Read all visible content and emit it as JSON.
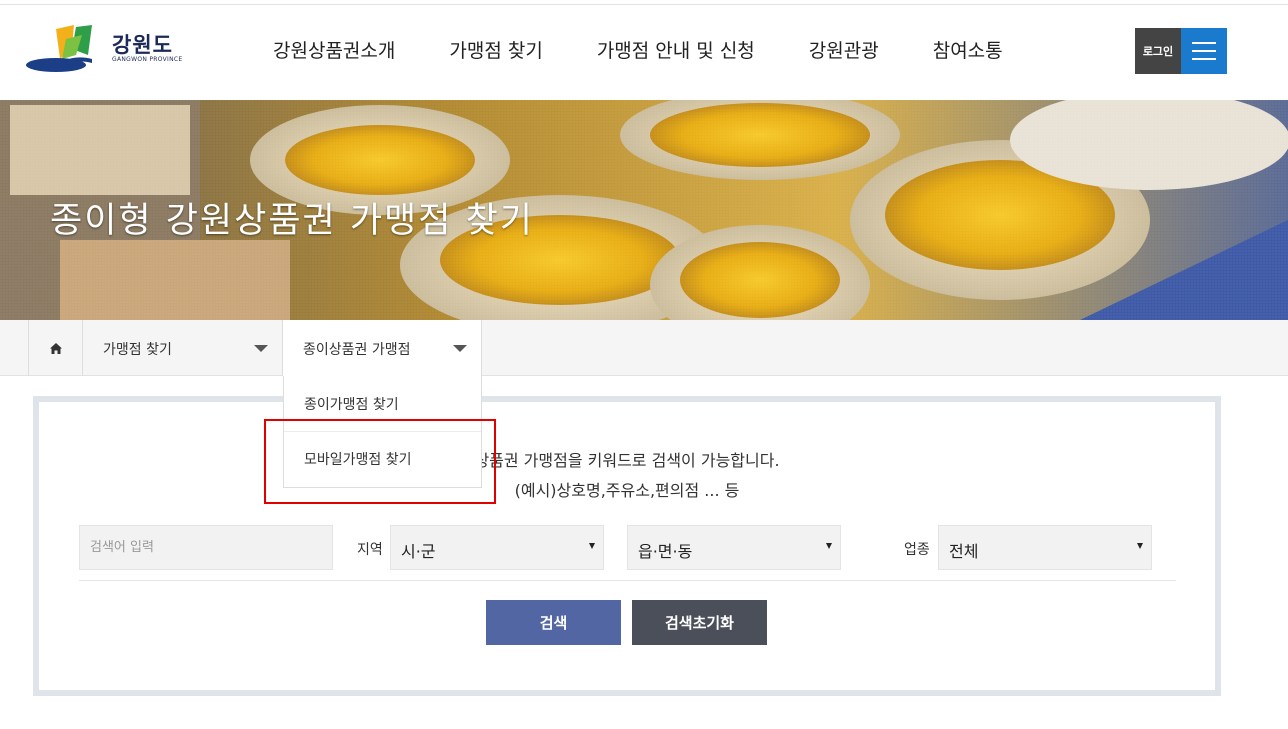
{
  "header": {
    "logo_text": "강원도",
    "logo_sub": "GANGWON PROVINCE",
    "nav": [
      "강원상품권소개",
      "가맹점 찾기",
      "가맹점 안내 및 신청",
      "강원관광",
      "참여소통"
    ],
    "login_label": "로그인",
    "menu_icon": "hamburger-icon",
    "menu_color": "#1a7bce"
  },
  "banner": {
    "title": "종이형 강원상품권 가맹점 찾기"
  },
  "breadcrumb": {
    "home_icon": "home-icon",
    "level1": "가맹점 찾기",
    "level2": "종이상품권 가맹점",
    "dropdown_items": [
      "종이가맹점 찾기",
      "모바일가맹점 찾기"
    ]
  },
  "search": {
    "description_line1": "상품권 가맹점을 키워드로 검색이 가능합니다.",
    "description_line2": "(예시)상호명,주유소,편의점 ... 등",
    "keyword_placeholder": "검색어 입력",
    "region_label": "지역",
    "region_city_value": "시·군",
    "region_town_value": "읍·면·동",
    "category_label": "업종",
    "category_value": "전체",
    "search_button": "검색",
    "reset_button": "검색초기화",
    "search_button_color": "#5166a3",
    "reset_button_color": "#4b4f5a"
  },
  "highlight_color": "#e00000"
}
